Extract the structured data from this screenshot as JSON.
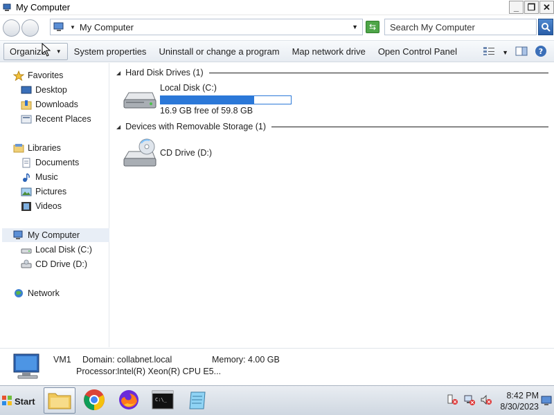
{
  "window": {
    "title": "My Computer",
    "controls": {
      "minimize": "_",
      "maximize": "❐",
      "close": "✕"
    }
  },
  "address": {
    "location": "My Computer",
    "search_placeholder": "Search My Computer"
  },
  "toolbar": {
    "organize": "Organize",
    "items": [
      "System properties",
      "Uninstall or change a program",
      "Map network drive",
      "Open Control Panel"
    ]
  },
  "sidebar": {
    "favorites": "Favorites",
    "desktop": "Desktop",
    "downloads": "Downloads",
    "recent_places": "Recent Places",
    "libraries": "Libraries",
    "documents": "Documents",
    "music": "Music",
    "pictures": "Pictures",
    "videos": "Videos",
    "my_computer": "My Computer",
    "local_disk": "Local Disk (C:)",
    "cd_drive": "CD Drive (D:)",
    "network": "Network"
  },
  "content": {
    "hard_disk_group": "Hard Disk Drives (1)",
    "removable_group": "Devices with Removable Storage (1)",
    "local_disk_name": "Local Disk (C:)",
    "local_disk_free": "16.9 GB free of 59.8 GB",
    "local_disk_used_fraction": 0.717,
    "cd_drive_name": "CD Drive (D:)"
  },
  "details": {
    "computer_name": "VM1",
    "domain_label": "Domain:",
    "domain_value": "collabnet.local",
    "memory_label": "Memory:",
    "memory_value": "4.00 GB",
    "processor_label": "Processor:",
    "processor_value": "Intel(R) Xeon(R) CPU E5..."
  },
  "taskbar": {
    "start_label": "Start",
    "time": "8:42 PM",
    "date": "8/30/2023"
  },
  "colors": {
    "accent": "#2b78d8",
    "selection": "#e8eef6"
  }
}
